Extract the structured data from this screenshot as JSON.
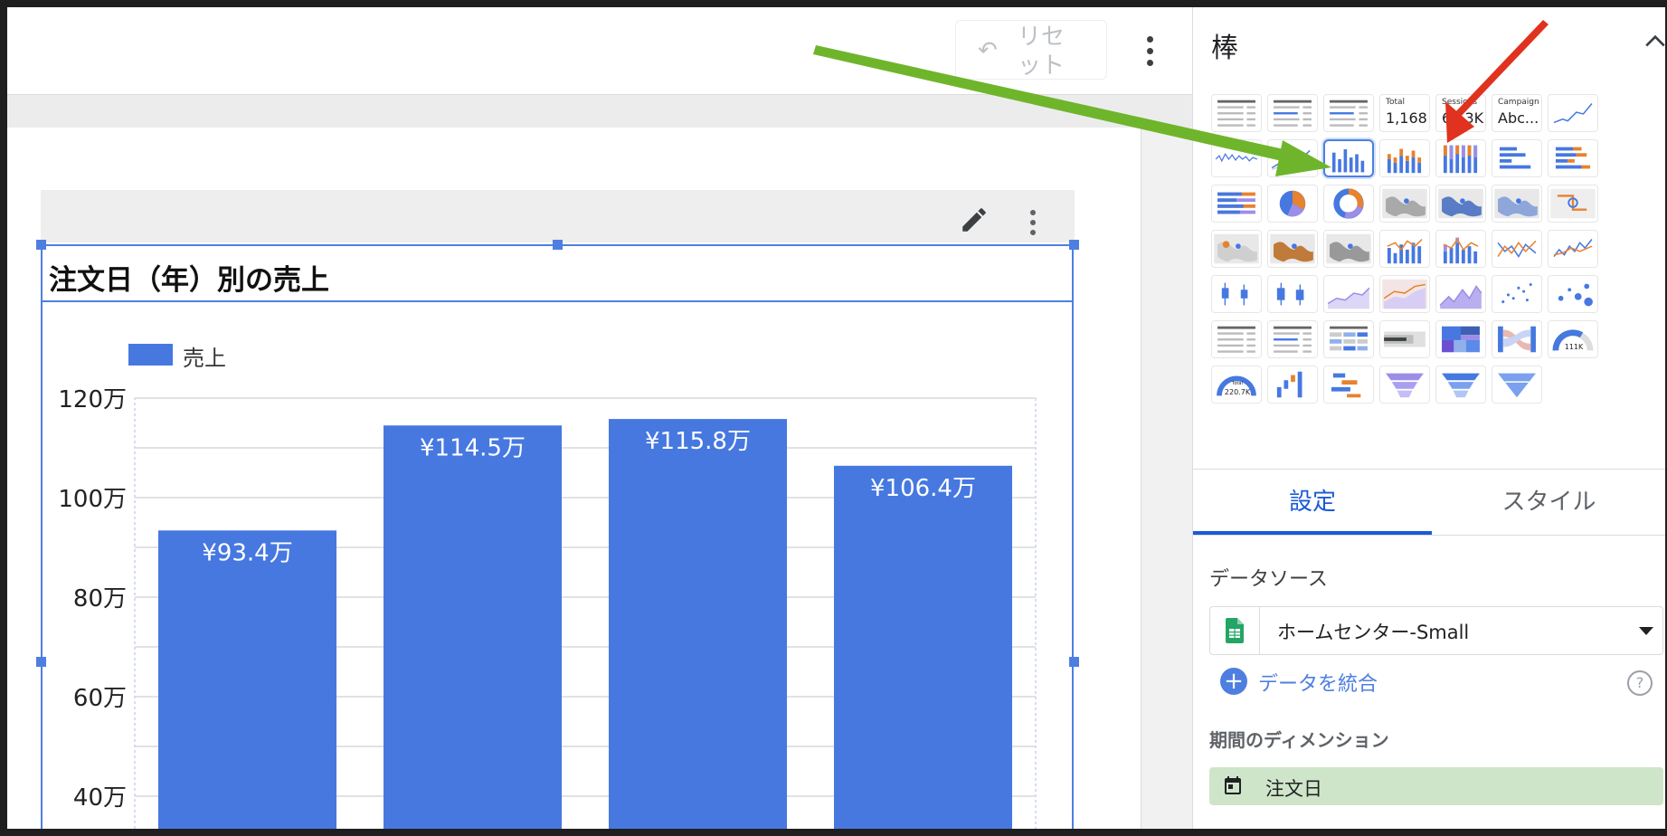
{
  "toolbar": {
    "reset_label": "リセット"
  },
  "chart": {
    "title": "注文日（年）別の売上",
    "legend_label": "売上"
  },
  "chart_data": {
    "type": "bar",
    "title": "注文日（年）別の売上",
    "series": [
      {
        "name": "売上",
        "values": [
          934000,
          1145000,
          1158000,
          1064000
        ],
        "labels": [
          "¥93.4万",
          "¥114.5万",
          "¥115.8万",
          "¥106.4万"
        ]
      }
    ],
    "y_ticks": [
      "40万",
      "60万",
      "80万",
      "100万",
      "120万"
    ],
    "ylim": [
      0,
      1200000
    ],
    "grid": true,
    "legend_position": "top-left"
  },
  "panel": {
    "title": "棒",
    "chart_types": {
      "scorecard_total_title": "Total",
      "scorecard_total_value": "1,168",
      "scorecard_sessions_title": "Sessions",
      "scorecard_sessions_value": "69.3K",
      "scorecard_campaign_title": "Campaign",
      "scorecard_campaign_value": "Abc...",
      "gauge_value": "111K",
      "gauge_total": "220.7K",
      "gauge_total_label": "Total"
    },
    "tabs": {
      "settings": "設定",
      "style": "スタイル"
    },
    "data_source_heading": "データソース",
    "data_source_name": "ホームセンター-Small",
    "blend_label": "データを統合",
    "dimension_heading": "期間のディメンション",
    "dimension_value": "注文日"
  },
  "colors": {
    "bar": "#4678e0",
    "selection": "#4e7fe0",
    "arrow_green": "#6fb52c",
    "arrow_red": "#e0321e",
    "orange": "#e8822e"
  }
}
